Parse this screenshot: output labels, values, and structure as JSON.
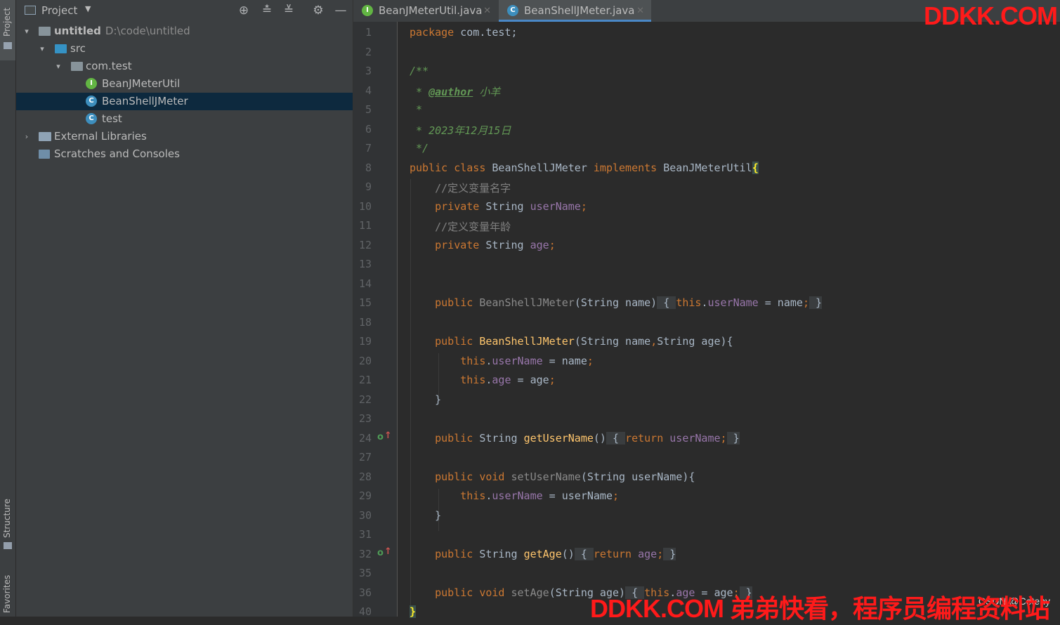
{
  "tool_strip": {
    "project": "Project",
    "structure": "Structure",
    "favorites": "Favorites"
  },
  "panel": {
    "title": "Project",
    "tree": {
      "root": "untitled",
      "root_path": "D:\\code\\untitled",
      "src": "src",
      "package": "com.test",
      "items": [
        "BeanJMeterUtil",
        "BeanShellJMeter",
        "test"
      ],
      "external": "External Libraries",
      "scratches": "Scratches and Consoles"
    }
  },
  "tabs": [
    {
      "label": "BeanJMeterUtil.java"
    },
    {
      "label": "BeanShellJMeter.java"
    }
  ],
  "gutter": {
    "line_numbers": [
      "1",
      "2",
      "3",
      "4",
      "5",
      "6",
      "7",
      "8",
      "9",
      "10",
      "11",
      "12",
      "13",
      "14",
      "15",
      "18",
      "19",
      "20",
      "21",
      "22",
      "23",
      "24",
      "27",
      "28",
      "29",
      "30",
      "31",
      "32",
      "35",
      "36",
      "40"
    ]
  },
  "code": {
    "l1_kw": "package",
    "l1_rest": " com.test;",
    "l3": "/**",
    "l4_a": " * ",
    "l4_tag": "@author",
    "l4_b": " 小羊",
    "l5": " *",
    "l6": " * 2023年12月15日",
    "l7": " */",
    "l8_kw": "public class",
    "l8_name": " BeanShellJMeter ",
    "l8_kw2": "implements",
    "l8_iface": " BeanJMeterUtil",
    "l8_brace": "{",
    "l9": "    //定义变量名字",
    "l10_kw": "    private",
    "l10_type": " String ",
    "l10_field": "userName",
    "l10_end": ";",
    "l11": "    //定义变量年龄",
    "l12_kw": "    private",
    "l12_type": " String ",
    "l12_field": "age",
    "l12_end": ";",
    "l15_kw": "    public",
    "l15_name": " BeanShellJMeter",
    "l15_params": "(String name)",
    "l15_open": " { ",
    "l15_this": "this",
    "l15_dot": ".",
    "l15_field": "userName",
    "l15_assign": " = name",
    "l15_semi": ";",
    "l15_close": " }",
    "l19_kw": "    public",
    "l19_name": " BeanShellJMeter",
    "l19_params": "(String name",
    "l19_comma": ",",
    "l19_params2": "String age){",
    "l20_this": "        this",
    "l20_dot": ".",
    "l20_field": "userName",
    "l20_rest": " = name",
    "l20_semi": ";",
    "l21_this": "        this",
    "l21_dot": ".",
    "l21_field": "age",
    "l21_rest": " = age",
    "l21_semi": ";",
    "l22": "    }",
    "l24_kw": "    public",
    "l24_type": " String ",
    "l24_fn": "getUserName",
    "l24_parens": "()",
    "l24_open": " { ",
    "l24_ret": "return",
    "l24_sp": " ",
    "l24_field": "userName",
    "l24_semi": ";",
    "l24_close": " }",
    "l28_kw": "    public void",
    "l28_fn": " setUserName",
    "l28_params": "(String userName){",
    "l29_this": "        this",
    "l29_dot": ".",
    "l29_field": "userName",
    "l29_rest": " = userName",
    "l29_semi": ";",
    "l30": "    }",
    "l32_kw": "    public",
    "l32_type": " String ",
    "l32_fn": "getAge",
    "l32_parens": "()",
    "l32_open": " { ",
    "l32_ret": "return",
    "l32_sp": " ",
    "l32_field": "age",
    "l32_semi": ";",
    "l32_close": " }",
    "l36_kw": "    public void",
    "l36_fn": " setAge",
    "l36_params": "(String age)",
    "l36_open": " { ",
    "l36_this": "this",
    "l36_dot": ".",
    "l36_field": "age",
    "l36_rest": " = age",
    "l36_semi": ";",
    "l36_close": " }",
    "l40": "}"
  },
  "watermarks": {
    "top": "DDKK.COM",
    "bottom": "DDKK.COM 弟弟快看，程序员编程资料站",
    "csdn": "CSDN @Ceteny"
  },
  "colors": {
    "keyword": "#cc7832",
    "field": "#9876aa",
    "method": "#ffc66d",
    "comment": "#808080",
    "doc": "#629755",
    "selection": "#0d293e",
    "watermark": "#ff1a1a"
  }
}
